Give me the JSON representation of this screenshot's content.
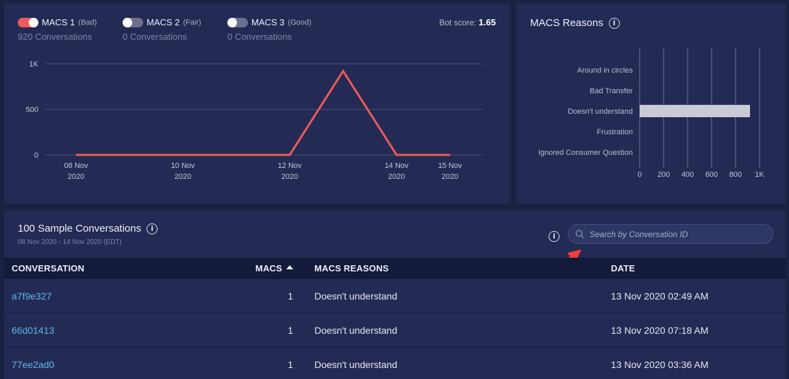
{
  "toggles": [
    {
      "label": "MACS 1",
      "quality": "(Bad)",
      "count": "920 Conversations",
      "on": true
    },
    {
      "label": "MACS 2",
      "quality": "(Fair)",
      "count": "0 Conversations",
      "on": false
    },
    {
      "label": "MACS 3",
      "quality": "(Good)",
      "count": "0 Conversations",
      "on": false
    }
  ],
  "bot_score": {
    "label": "Bot score:",
    "value": "1.65"
  },
  "reasons_panel": {
    "title": "MACS Reasons"
  },
  "conversations": {
    "title": "100 Sample Conversations",
    "range": "08 Nov 2020 - 14 Nov 2020 (EDT)",
    "search_placeholder": "Search by Conversation ID",
    "columns": [
      "CONVERSATION",
      "MACS",
      "MACS REASONS",
      "DATE"
    ],
    "rows": [
      {
        "id": "a7f9e327",
        "macs": "1",
        "reason": "Doesn't understand",
        "date": "13 Nov 2020 02:49 AM"
      },
      {
        "id": "66d01413",
        "macs": "1",
        "reason": "Doesn't understand",
        "date": "13 Nov 2020 07:18 AM"
      },
      {
        "id": "77ee2ad0",
        "macs": "1",
        "reason": "Doesn't understand",
        "date": "13 Nov 2020 03:36 AM"
      }
    ]
  },
  "colors": {
    "accent": "#ef5a5a",
    "link": "#5bb8e8",
    "bar": "#c9cad6",
    "panel": "#232b54",
    "annotation_arrow": "#ef3f3a"
  },
  "chart_data": [
    {
      "type": "line",
      "x": [
        "08 Nov 2020",
        "09 Nov 2020",
        "10 Nov 2020",
        "11 Nov 2020",
        "12 Nov 2020",
        "13 Nov 2020",
        "14 Nov 2020",
        "15 Nov 2020"
      ],
      "tick_labels": [
        {
          "date": "08 Nov 2020",
          "line1": "08 Nov",
          "line2": "2020"
        },
        {
          "date": "10 Nov 2020",
          "line1": "10 Nov",
          "line2": "2020"
        },
        {
          "date": "12 Nov 2020",
          "line1": "12 Nov",
          "line2": "2020"
        },
        {
          "date": "14 Nov 2020",
          "line1": "14 Nov",
          "line2": "2020"
        },
        {
          "date": "15 Nov 2020",
          "line1": "15 Nov",
          "line2": "2020"
        }
      ],
      "series": [
        {
          "name": "MACS 1",
          "values": [
            0,
            0,
            0,
            0,
            0,
            920,
            0,
            0
          ]
        }
      ],
      "yticks": [
        "0",
        "500",
        "1K"
      ],
      "ylim": [
        0,
        1000
      ],
      "grid": true
    },
    {
      "type": "bar",
      "orientation": "horizontal",
      "categories": [
        "Around in circles",
        "Bad Transfer",
        "Doesn't understand",
        "Frustration",
        "Ignored Consumer Question"
      ],
      "values": [
        0,
        0,
        920,
        0,
        0
      ],
      "xticks": [
        "0",
        "200",
        "400",
        "600",
        "800",
        "1K"
      ],
      "xlim": [
        0,
        1000
      ],
      "grid": true
    }
  ]
}
